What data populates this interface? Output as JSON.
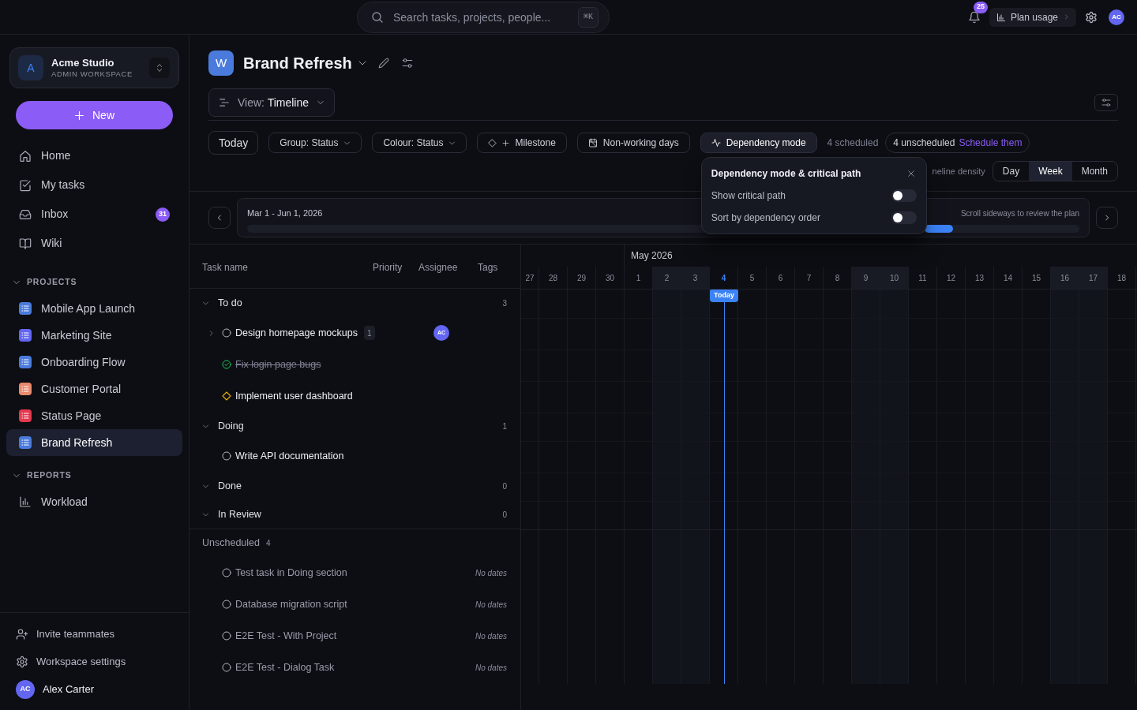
{
  "top_bar": {
    "search": {
      "placeholder": "Search tasks, projects, people...",
      "shortcut": "⌘K"
    },
    "notifications": {
      "count": "25"
    },
    "plan_usage": "Plan usage",
    "avatar": "AC"
  },
  "sidebar": {
    "workspace": {
      "initial": "A",
      "name": "Acme Studio",
      "subtitle": "ADMIN WORKSPACE"
    },
    "new_button": "New",
    "nav": [
      {
        "kind": "home",
        "label": "Home",
        "selected": false
      },
      {
        "kind": "tasks",
        "label": "My tasks",
        "selected": false
      },
      {
        "kind": "inbox",
        "label": "Inbox",
        "badge": "31",
        "selected": false
      },
      {
        "kind": "wiki",
        "label": "Wiki",
        "selected": false
      }
    ],
    "sections": [
      {
        "title": "PROJECTS",
        "expanded": true,
        "items": [
          {
            "kind": "project",
            "label": "Mobile App Launch",
            "color": "#4a7bdc",
            "selected": false
          },
          {
            "kind": "project",
            "label": "Marketing Site",
            "color": "#6366f1",
            "selected": false
          },
          {
            "kind": "project",
            "label": "Onboarding Flow",
            "color": "#4a7bdc",
            "selected": false
          },
          {
            "kind": "project",
            "label": "Customer Portal",
            "color": "#e98a6c",
            "selected": false
          },
          {
            "kind": "project",
            "label": "Status Page",
            "color": "#e5384f",
            "selected": false
          },
          {
            "kind": "project",
            "label": "Brand Refresh",
            "color": "#4a7bdc",
            "selected": true
          }
        ]
      },
      {
        "title": "REPORTS",
        "expanded": true,
        "items": [
          {
            "kind": "report",
            "label": "Workload",
            "selected": false
          }
        ]
      }
    ],
    "footer": [
      {
        "kind": "invite",
        "label": "Invite teammates"
      },
      {
        "kind": "settings",
        "label": "Workspace settings"
      }
    ],
    "user": {
      "initials": "AC",
      "name": "Alex Carter"
    }
  },
  "project_header": {
    "initial": "W",
    "title": "Brand Refresh",
    "view_prefix": "View:",
    "view": "Timeline"
  },
  "toolbar": {
    "items": [
      {
        "kind": "plain",
        "label": "Today"
      },
      {
        "kind": "dropdown",
        "label": "Group: Status"
      },
      {
        "kind": "dropdown",
        "label": "Colour: Status"
      },
      {
        "kind": "milestone",
        "label": "Milestone"
      },
      {
        "kind": "nonworking",
        "label": "Non-working days",
        "active": false
      },
      {
        "kind": "dependency",
        "label": "Dependency mode",
        "active": true
      }
    ],
    "scheduled": "4 scheduled",
    "unscheduled": "4 unscheduled",
    "schedule_link": "Schedule them"
  },
  "density": {
    "label": "neline density",
    "options": [
      {
        "label": "Day",
        "selected": false
      },
      {
        "label": "Week",
        "selected": true
      },
      {
        "label": "Month",
        "selected": false
      }
    ]
  },
  "dependency_popover": {
    "title": "Dependency mode & critical path",
    "options": [
      {
        "label": "Show critical path",
        "on": false
      },
      {
        "label": "Sort by dependency order",
        "on": false
      }
    ]
  },
  "range_bar": {
    "range": "Mar 1 - Jun 1, 2026",
    "hint": "Scroll sideways to review the plan"
  },
  "task_table": {
    "columns": [
      "Task name",
      "Priority",
      "Assignee",
      "Tags"
    ],
    "groups": [
      {
        "label": "To do",
        "count": "3",
        "expanded": true,
        "tasks": [
          {
            "name": "Design homepage mockups",
            "kind": "open",
            "subtasks": {
              "count": "1",
              "expanded": false
            },
            "assignee": "AC"
          },
          {
            "name": "Fix login page bugs",
            "kind": "done"
          },
          {
            "name": "Implement user dashboard",
            "kind": "milestone"
          }
        ]
      },
      {
        "label": "Doing",
        "count": "1",
        "expanded": true,
        "tasks": [
          {
            "name": "Write API documentation",
            "kind": "open"
          }
        ]
      },
      {
        "label": "Done",
        "count": "0",
        "expanded": true
      },
      {
        "label": "In Review",
        "count": "0",
        "expanded": true
      }
    ],
    "unscheduled": {
      "label": "Unscheduled",
      "count": "4",
      "tasks": [
        {
          "name": "Test task in Doing section",
          "kind": "open",
          "dates": "No dates"
        },
        {
          "name": "Database migration script",
          "kind": "open",
          "dates": "No dates"
        },
        {
          "name": "E2E Test - With Project",
          "kind": "open",
          "dates": "No dates"
        },
        {
          "name": "E2E Test - Dialog Task",
          "kind": "open",
          "dates": "No dates"
        }
      ]
    }
  },
  "timeline": {
    "month": "May 2026",
    "today_label": "Today",
    "days": [
      {
        "label": "27",
        "weekend": false,
        "today": false
      },
      {
        "label": "28",
        "weekend": false,
        "today": false
      },
      {
        "label": "29",
        "weekend": false,
        "today": false
      },
      {
        "label": "30",
        "weekend": false,
        "today": false
      },
      {
        "label": "1",
        "weekend": false,
        "today": false
      },
      {
        "label": "2",
        "weekend": true,
        "today": false
      },
      {
        "label": "3",
        "weekend": true,
        "today": false
      },
      {
        "label": "4",
        "weekend": false,
        "today": true
      },
      {
        "label": "5",
        "weekend": false,
        "today": false
      },
      {
        "label": "6",
        "weekend": false,
        "today": false
      },
      {
        "label": "7",
        "weekend": false,
        "today": false
      },
      {
        "label": "8",
        "weekend": false,
        "today": false
      },
      {
        "label": "9",
        "weekend": true,
        "today": false
      },
      {
        "label": "10",
        "weekend": true,
        "today": false
      },
      {
        "label": "11",
        "weekend": false,
        "today": false
      },
      {
        "label": "12",
        "weekend": false,
        "today": false
      },
      {
        "label": "13",
        "weekend": false,
        "today": false
      },
      {
        "label": "14",
        "weekend": false,
        "today": false
      },
      {
        "label": "15",
        "weekend": false,
        "today": false
      },
      {
        "label": "16",
        "weekend": true,
        "today": false
      },
      {
        "label": "17",
        "weekend": true,
        "today": false
      },
      {
        "label": "18",
        "weekend": false,
        "today": false
      }
    ]
  }
}
